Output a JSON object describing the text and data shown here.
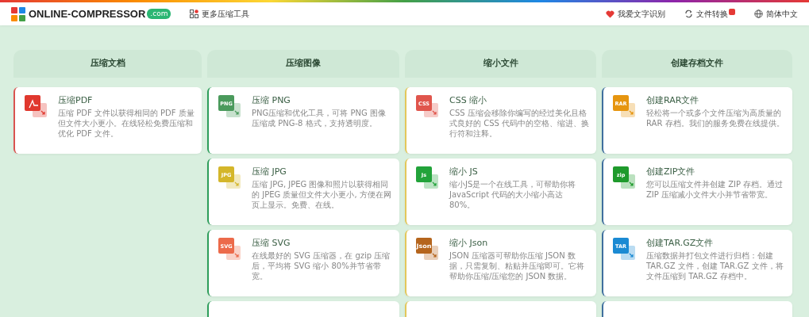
{
  "header": {
    "logo_text": "ONLINE-COMPRESSOR",
    "logo_domain": ".com",
    "more_tools": "更多压缩工具",
    "links": [
      {
        "kind": "heart",
        "label": "我爱文字识别"
      },
      {
        "kind": "convert",
        "label": "文件转换"
      },
      {
        "kind": "globe",
        "label": "简体中文"
      }
    ]
  },
  "columns": [
    {
      "title": "压缩文档",
      "color": "#d9534f",
      "continues": false,
      "tools": [
        {
          "title": "压缩PDF",
          "kind": "pdf",
          "color": "#e0382e",
          "description": "压缩 PDF 文件以获得相同的 PDF 质量但文件大小更小。在线轻松免费压缩和优化 PDF 文件。"
        }
      ]
    },
    {
      "title": "压缩图像",
      "color": "#2e9e5b",
      "continues": true,
      "tools": [
        {
          "title": "压缩 PNG",
          "badge": "PNG",
          "kind": "badge",
          "color": "#4a9a5c",
          "description": "PNG压缩和优化工具，可将 PNG 图像压缩成 PNG-8 格式，支持透明度。"
        },
        {
          "title": "压缩 JPG",
          "badge": "JPG",
          "kind": "badge",
          "color": "#d4b62a",
          "description": "压缩 JPG, JPEG 图像和照片以获得相同的 JPEG 质量但文件大小更小, 方便在网页上显示。免费、在线。"
        },
        {
          "title": "压缩 SVG",
          "badge": "SVG",
          "kind": "badge",
          "color": "#ec6a4a",
          "description": "在线最好的 SVG 压缩器，在 gzip 压缩后，平均将 SVG 缩小 80%并节省带宽。"
        }
      ]
    },
    {
      "title": "缩小文件",
      "color": "#e3c75a",
      "continues": true,
      "tools": [
        {
          "title": "CSS 缩小",
          "badge": "CSS",
          "kind": "badge",
          "color": "#e0554c",
          "description": "CSS 压缩会移除你编写的经过美化且格式良好的 CSS 代码中的空格、缩进、换行符和注释。"
        },
        {
          "title": "缩小 JS",
          "badge": "Js",
          "kind": "badge",
          "color": "#22a33a",
          "description": "缩小JS是一个在线工具，可帮助你将 JavaScript 代码的大小缩小高达 80%。"
        },
        {
          "title": "缩小 Json",
          "badge": "Json",
          "kind": "badge",
          "color": "#b5651d",
          "description": "JSON 压缩器可帮助你压缩 JSON 数据，只需复制、粘贴并压缩即可。它将帮助你压缩/压缩您的 JSON 数据。"
        }
      ]
    },
    {
      "title": "创建存档文件",
      "color": "#3f6f9e",
      "continues": true,
      "tools": [
        {
          "title": "创建RAR文件",
          "badge": "RAR",
          "kind": "badge",
          "color": "#e6950f",
          "description": "轻松将一个或多个文件压缩为高质量的 RAR 存档。我们的服务免费在线提供。"
        },
        {
          "title": "创建ZIP文件",
          "badge": "zip",
          "kind": "badge",
          "color": "#1f9a2c",
          "description": "您可以压缩文件并创建 ZIP 存档。通过 ZIP 压缩减小文件大小并节省带宽。"
        },
        {
          "title": "创建TAR.GZ文件",
          "badge": "TAR",
          "kind": "badge",
          "color": "#1b8ad3",
          "description": "压缩数据并打包文件进行归档：创建 TAR.GZ 文件，创建 TAR.GZ 文件，将文件压缩到 TAR.GZ 存档中。"
        }
      ]
    }
  ]
}
